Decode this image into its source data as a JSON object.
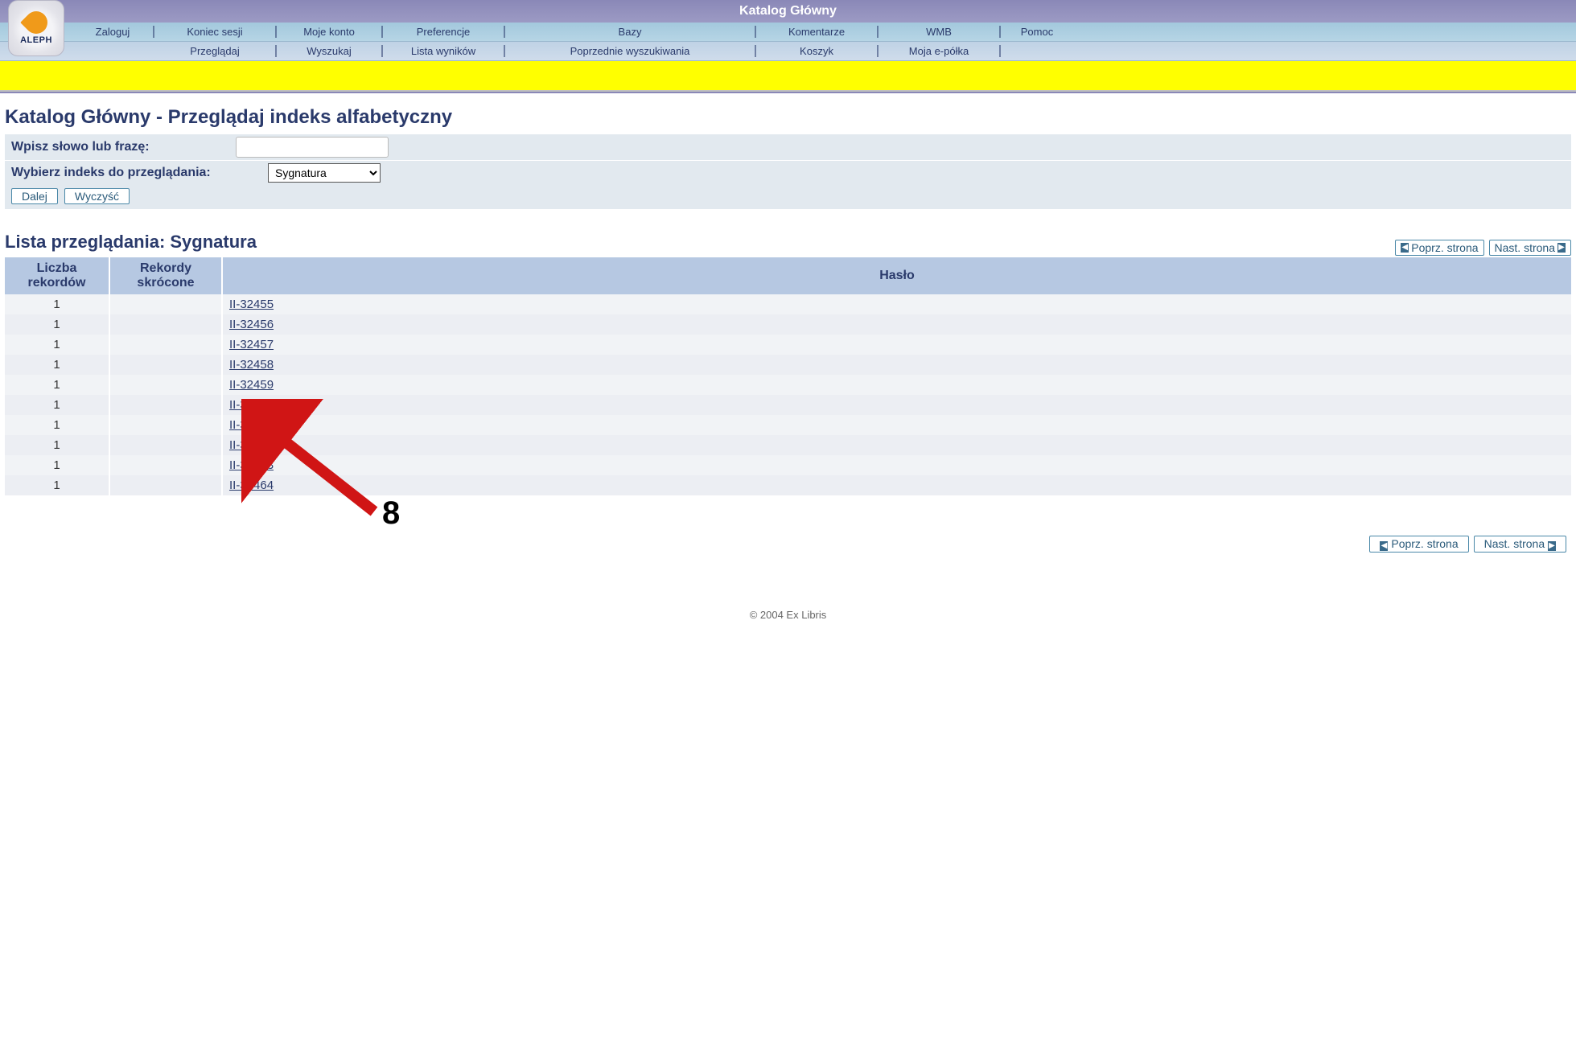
{
  "banner": {
    "title": "Katalog Główny"
  },
  "logo": {
    "text": "ALEPH"
  },
  "nav_row1": [
    {
      "label": "Zaloguj"
    },
    {
      "label": "Koniec sesji"
    },
    {
      "label": "Moje konto"
    },
    {
      "label": "Preferencje"
    },
    {
      "label": "Bazy"
    },
    {
      "label": "Komentarze"
    },
    {
      "label": "WMB"
    },
    {
      "label": "Pomoc"
    }
  ],
  "nav_row2": [
    {
      "label": "Przeglądaj"
    },
    {
      "label": "Wyszukaj"
    },
    {
      "label": "Lista wyników"
    },
    {
      "label": "Poprzednie wyszukiwania"
    },
    {
      "label": "Koszyk"
    },
    {
      "label": "Moja e-półka"
    }
  ],
  "page_title": "Katalog Główny - Przeglądaj indeks alfabetyczny",
  "form": {
    "phrase_label": "Wpisz słowo lub frazę:",
    "phrase_value": "",
    "index_label": "Wybierz indeks do przeglądania:",
    "index_selected": "Sygnatura",
    "go": "Dalej",
    "clear": "Wyczyść"
  },
  "list": {
    "title": "Lista przeglądania: Sygnatura",
    "prev": "Poprz. strona",
    "next": "Nast. strona",
    "col_count": "Liczba rekordów",
    "col_short": "Rekordy skrócone",
    "col_entry": "Hasło",
    "rows": [
      {
        "count": "1",
        "entry": "II-32455"
      },
      {
        "count": "1",
        "entry": "II-32456"
      },
      {
        "count": "1",
        "entry": "II-32457"
      },
      {
        "count": "1",
        "entry": "II-32458"
      },
      {
        "count": "1",
        "entry": "II-32459"
      },
      {
        "count": "1",
        "entry": "II-32460"
      },
      {
        "count": "1",
        "entry": "II-32461"
      },
      {
        "count": "1",
        "entry": "II-32462"
      },
      {
        "count": "1",
        "entry": "II-32463"
      },
      {
        "count": "1",
        "entry": "II-32464"
      }
    ]
  },
  "annotation": {
    "number": "8"
  },
  "footer": "© 2004 Ex Libris"
}
